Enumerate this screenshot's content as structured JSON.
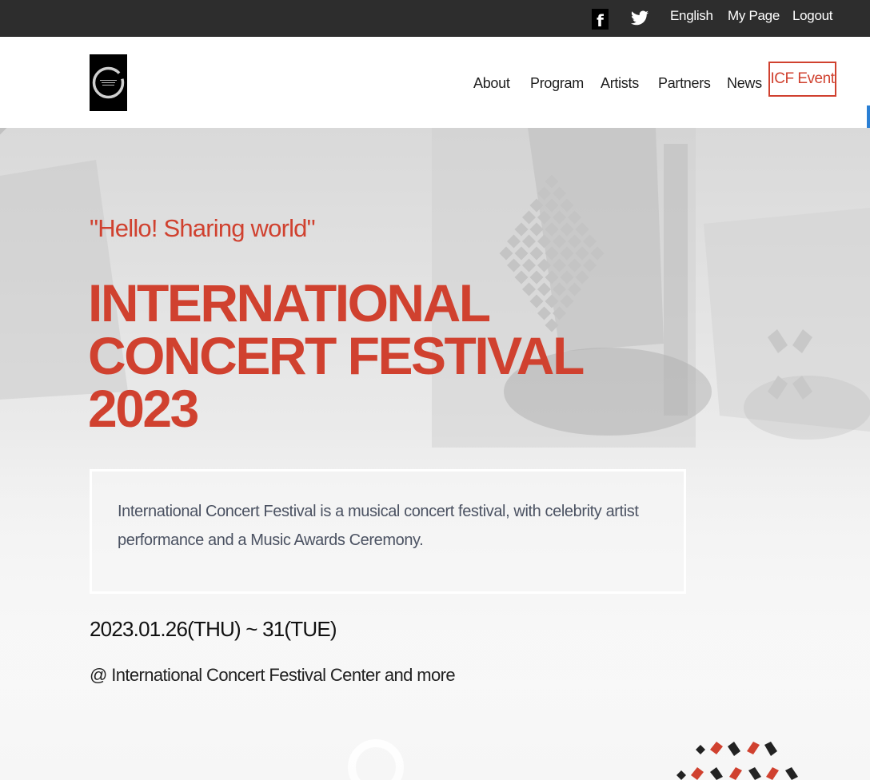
{
  "topbar": {
    "facebook_icon": "facebook-icon",
    "twitter_icon": "twitter-icon",
    "language": "English",
    "my_page": "My Page",
    "logout": "Logout"
  },
  "header": {
    "logo_icon": "circle-logo",
    "nav": [
      {
        "label": "About"
      },
      {
        "label": "Program"
      },
      {
        "label": "Artists"
      },
      {
        "label": "Partners"
      },
      {
        "label": "News"
      }
    ],
    "event_button": "ICF Event"
  },
  "hero": {
    "tagline": "\"Hello! Sharing world\"",
    "title_lines": [
      "INTERNATIONAL",
      "CONCERT FESTIVAL",
      "2023"
    ],
    "description": "International Concert Festival is a musical concert festival, with celebrity artist performance and a Music Awards Ceremony.",
    "dates": "2023.01.26(THU) ~ 31(TUE)",
    "venue": "@ International Concert Festival Center and more"
  },
  "colors": {
    "accent": "#d0412f",
    "topbar_bg": "#2d2d2d",
    "text_dark": "#1e1e1e",
    "desc_text": "#4b5262"
  }
}
